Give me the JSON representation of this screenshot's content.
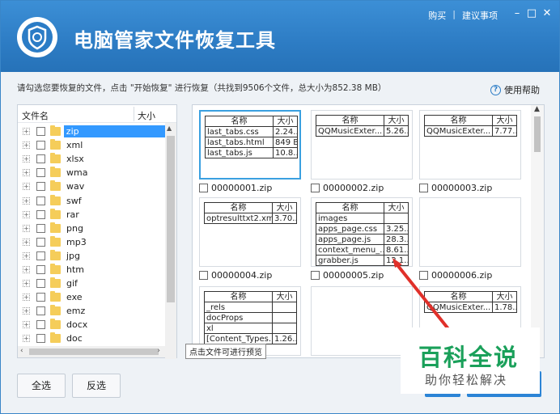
{
  "window": {
    "title": "电脑管家文件恢复工具",
    "nav": {
      "buy": "购买",
      "separator": "|",
      "suggest": "建议事项"
    },
    "controls": {
      "minimize": "–",
      "maximize": "□",
      "close": "✕"
    }
  },
  "info": {
    "text": "请勾选您要恢复的文件，点击 \"开始恢复\" 进行恢复（共找到9506个文件，总大小为852.38 MB）",
    "help_label": "使用帮助",
    "help_icon": "?"
  },
  "tree": {
    "col_name": "文件名",
    "col_size": "大小",
    "expander": "+",
    "items": [
      "zip",
      "xml",
      "xlsx",
      "wma",
      "wav",
      "swf",
      "rar",
      "png",
      "mp3",
      "jpg",
      "htm",
      "gif",
      "exe",
      "emz",
      "docx",
      "doc"
    ],
    "selected_index": 0
  },
  "preview": {
    "col_name": "名称",
    "col_size": "大小",
    "cards": [
      {
        "caption": "00000001.zip",
        "selected": true,
        "rows": [
          [
            "last_tabs.css",
            "2.24..."
          ],
          [
            "last_tabs.html",
            "849 B"
          ],
          [
            "last_tabs.js",
            "10.8..."
          ]
        ]
      },
      {
        "caption": "00000002.zip",
        "selected": false,
        "rows": [
          [
            "QQMusicExter...",
            "5.26..."
          ]
        ]
      },
      {
        "caption": "00000003.zip",
        "selected": false,
        "rows": [
          [
            "QQMusicExter...",
            "7.77..."
          ]
        ]
      },
      {
        "caption": "00000004.zip",
        "selected": false,
        "rows": [
          [
            "optresulttxt2.xml",
            "3.70..."
          ]
        ]
      },
      {
        "caption": "00000005.zip",
        "selected": false,
        "rows": [
          [
            "images",
            ""
          ],
          [
            "apps_page.css",
            "3.25..."
          ],
          [
            "apps_page.js",
            "28.3..."
          ],
          [
            "context_menu_...",
            "8.61..."
          ],
          [
            "grabber.js",
            "12.1..."
          ]
        ]
      },
      {
        "caption": "00000006.zip",
        "selected": false,
        "rows": []
      },
      {
        "caption": "",
        "selected": false,
        "rows": [
          [
            "_rels",
            ""
          ],
          [
            "docProps",
            ""
          ],
          [
            "xl",
            ""
          ],
          [
            "[Content_Types...",
            "1.26..."
          ]
        ]
      },
      {
        "caption": "",
        "selected": false,
        "rows": []
      },
      {
        "caption": "",
        "selected": false,
        "rows": [
          [
            "QQMusicExter...",
            "1.78..."
          ]
        ]
      }
    ],
    "tooltip": "点击文件可进行预览"
  },
  "buttons": {
    "select_all": "全选",
    "invert": "反选"
  },
  "watermark": {
    "title": "百科全说",
    "subtitle": "助你轻松解决"
  },
  "colors": {
    "header": "#2d7cc4",
    "selection": "#3399ff",
    "arrow": "#e0302a",
    "watermark": "#1aa05a"
  }
}
